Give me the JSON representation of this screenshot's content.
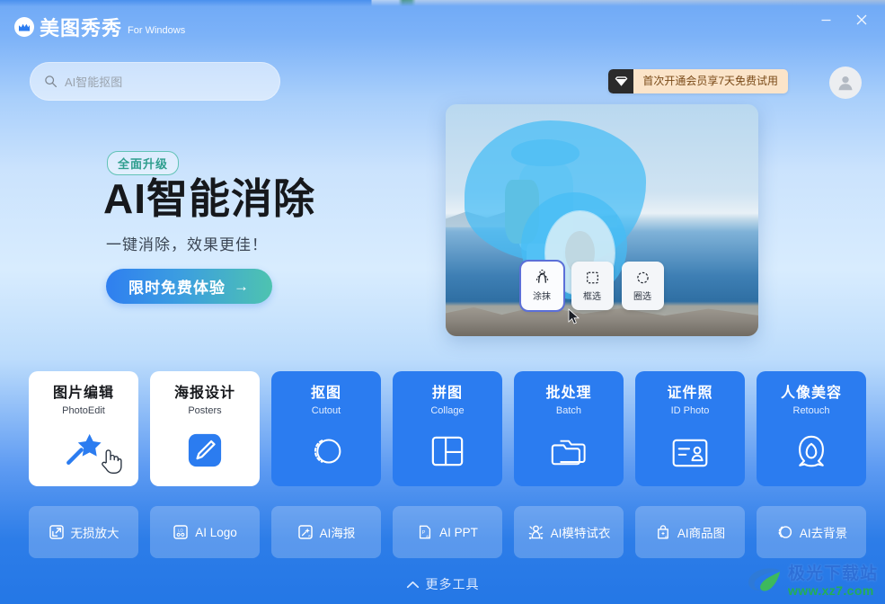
{
  "window": {
    "title": "美图秀秀 For Windows",
    "minimize_label": "最小化",
    "close_label": "关闭"
  },
  "header": {
    "brand_name": "美图秀秀",
    "brand_sub": "For Windows",
    "logo_icon": "meitu-logo-icon",
    "search": {
      "placeholder": "AI智能抠图",
      "value": "",
      "icon": "search-icon"
    },
    "vip_badge": {
      "text": "首次开通会员享7天免费试用",
      "icon": "gem-icon"
    },
    "avatar_icon": "user-avatar-icon"
  },
  "hero": {
    "badge": "全面升级",
    "title": "AI智能消除",
    "subtitle": "一键消除，效果更佳！",
    "cta_label": "限时免费体验",
    "cta_arrow": "→",
    "photo_alt": "seaside-traveler-photo",
    "chips": [
      {
        "label": "涂抹",
        "icon": "brush-selection-icon",
        "active": true
      },
      {
        "label": "框选",
        "icon": "rect-selection-icon",
        "active": false
      },
      {
        "label": "圈选",
        "icon": "lasso-selection-icon",
        "active": false
      }
    ]
  },
  "tiles": [
    {
      "cn": "图片编辑",
      "en": "PhotoEdit",
      "style": "white",
      "icon": "magic-wand-icon",
      "hovered": true
    },
    {
      "cn": "海报设计",
      "en": "Posters",
      "style": "white",
      "icon": "pencil-square-icon",
      "hovered": false
    },
    {
      "cn": "抠图",
      "en": "Cutout",
      "style": "blue",
      "icon": "cutout-circle-icon",
      "hovered": false
    },
    {
      "cn": "拼图",
      "en": "Collage",
      "style": "blue",
      "icon": "collage-grid-icon",
      "hovered": false
    },
    {
      "cn": "批处理",
      "en": "Batch",
      "style": "blue",
      "icon": "folder-stack-icon",
      "hovered": false
    },
    {
      "cn": "证件照",
      "en": "ID Photo",
      "style": "blue",
      "icon": "id-card-icon",
      "hovered": false
    },
    {
      "cn": "人像美容",
      "en": "Retouch",
      "style": "blue",
      "icon": "face-retouch-icon",
      "hovered": false
    }
  ],
  "ai_tools": [
    {
      "label": "无损放大",
      "icon": "upscale-icon"
    },
    {
      "label": "AI Logo",
      "icon": "logo-grid-icon"
    },
    {
      "label": "AI海报",
      "icon": "ai-poster-icon"
    },
    {
      "label": "AI PPT",
      "icon": "ai-ppt-icon"
    },
    {
      "label": "AI模特试衣",
      "icon": "ai-model-tryon-icon"
    },
    {
      "label": "AI商品图",
      "icon": "ai-product-icon"
    },
    {
      "label": "AI去背景",
      "icon": "ai-remove-bg-icon"
    }
  ],
  "footer": {
    "more_tools_label": "更多工具",
    "more_tools_icon": "chevron-up-icon"
  },
  "watermark": {
    "cn": "极光下载站",
    "url": "www.xz7.com",
    "icon": "aurora-swirl-icon"
  },
  "colors": {
    "brand_blue": "#2b7cf0",
    "tile_blue": "#2b7cf0",
    "badge_teal": "#2f9e8e",
    "vip_bg": "#fbe4c9",
    "vip_text": "#7a4a18",
    "page_top": "#6fa9f6",
    "page_bottom": "#2477e6"
  }
}
